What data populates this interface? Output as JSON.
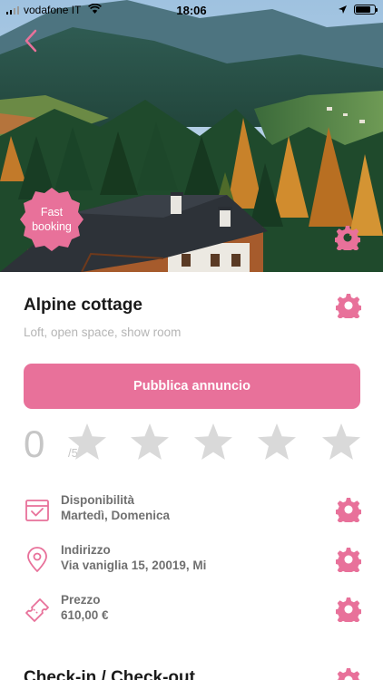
{
  "status_bar": {
    "carrier": "vodafone IT",
    "time": "18:06",
    "battery_level": 0.78
  },
  "hero": {
    "badge_line1": "Fast",
    "badge_line2": "booking"
  },
  "listing": {
    "title": "Alpine cottage",
    "subtitle": "Loft, open space, show room"
  },
  "publish_button": "Pubblica annuncio",
  "rating": {
    "score": "0",
    "max": "/5",
    "stars_filled": 0,
    "stars_total": 5
  },
  "details": [
    {
      "icon": "calendar-check-icon",
      "label": "Disponibilità",
      "value": "Martedì, Domenica"
    },
    {
      "icon": "location-pin-icon",
      "label": "Indirizzo",
      "value": "Via vaniglia 15, 20019, Mi"
    },
    {
      "icon": "ticket-icon",
      "label": "Prezzo",
      "value": "610,00 €"
    }
  ],
  "next_section_title": "Check-in / Check-out",
  "colors": {
    "accent": "#e8719a",
    "muted_text": "#707070",
    "star_empty": "#d9d9d9"
  }
}
